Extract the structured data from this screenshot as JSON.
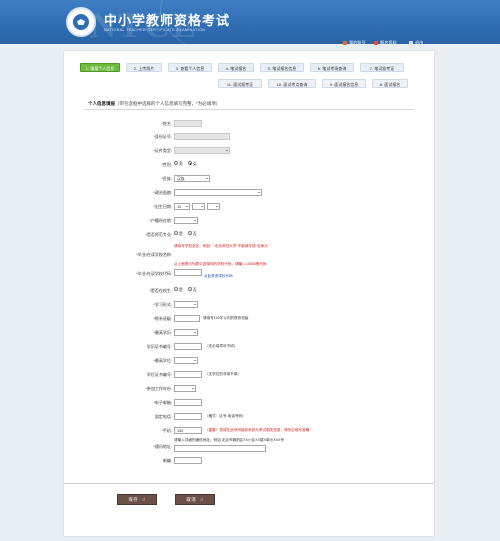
{
  "header": {
    "title": "中小学教师资格考试",
    "subtitle": "NATIONAL TEACHER CERTIFICATE EXAMINATION",
    "watermark": "NTCE",
    "links": [
      "我的账号",
      "报名资料",
      "退出"
    ]
  },
  "steps": [
    {
      "label": "1. 填报个人信息",
      "active": true
    },
    {
      "label": "2. 上传照片"
    },
    {
      "label": "3. 查看个人信息"
    },
    {
      "label": "4. 笔试报名"
    },
    {
      "label": "5. 笔试报名信息"
    },
    {
      "label": "6. 笔试考场查询"
    },
    {
      "label": "7. 笔试准考证"
    },
    {
      "label": "11. 面试报考证"
    },
    {
      "label": "10. 面试考点查询"
    },
    {
      "label": "9. 面试报名信息"
    },
    {
      "label": "8. 面试报名"
    }
  ],
  "section": {
    "title": "个人信息填报",
    "note": "（带包含框中选择的个人信息填写完整，*为必填项）"
  },
  "form": {
    "name_label": "*姓名:",
    "id_label": "*身份证号:",
    "idtype_label": "*证件类型:",
    "gender_label": "*性别:",
    "gender_male": "男",
    "gender_female": "女",
    "nation_label": "*民族:",
    "nation_value": "汉族",
    "politics_label": "*政治面貌:",
    "birth_label": "*出生日期:",
    "birth_y": "19",
    "birth_m": "",
    "birth_d": "",
    "hukou_label": "*户籍所在地:",
    "fresh_label": "*是否师范专业:",
    "yes": "是",
    "no": "否",
    "school_label": "*毕业/在读学校名称:",
    "school_hint": "请填写学校全名，例如：\"北京师范大学\"不能填写成\"北师大\"",
    "school_code_label": "*毕业/在读学校代码:",
    "school_code_hint": "从上面提示列表中选择你的学校代码，请输入10000等代码",
    "school_code_link": "点此查询学校代码",
    "in_school_label": "*是否在校生:",
    "study_form_label": "*学习形式:",
    "dept_label": "*院系班级:",
    "dept_hint": "请填写100字以内的院系班级",
    "edu_label": "*最高学历:",
    "edu_cert_label": "学历证书编号:",
    "edu_cert_hint": "（非必填项可不填）",
    "degree_label": "*最高学位:",
    "degree_cert_label": "学位证书编号:",
    "degree_cert_hint": "（无学位的非填不填）",
    "work_year_label": "*参加工作年份:",
    "email_label": "*电子邮箱:",
    "phone_label": "固定电话:",
    "phone_hint": "（格式：区号-电话号码）",
    "mobile_label": "*手机:",
    "mobile_value": "132",
    "mobile_hint": "（重要！您将在此号码接收系统与考试相关信息，请务必填写准确）",
    "address_label": "*通讯地址:",
    "address_hint": "请输入详细的通信地址，例如 北京市朝阳区XX小区XX楼X单元XXX号",
    "postcode_label": "邮编:"
  },
  "buttons": {
    "save": "保存",
    "cancel": "取消"
  },
  "colors": {
    "banner": "#2f6db3",
    "step_active": "#6cbb3c",
    "button": "#6a5048",
    "hint_red": "#d61414"
  }
}
